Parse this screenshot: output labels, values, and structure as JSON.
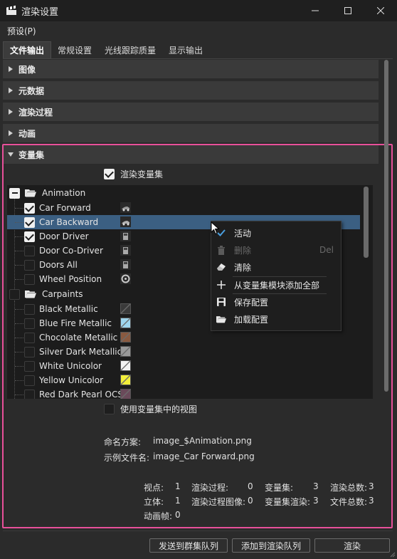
{
  "window": {
    "title": "渲染设置",
    "app_icon": "clapperboard-icon"
  },
  "menu": {
    "presets": "预设(P)"
  },
  "tabs": [
    {
      "label": "文件输出",
      "active": true
    },
    {
      "label": "常规设置",
      "active": false
    },
    {
      "label": "光线跟踪质量",
      "active": false
    },
    {
      "label": "显示输出",
      "active": false
    }
  ],
  "sections": [
    {
      "label": "图像",
      "expanded": false
    },
    {
      "label": "元数据",
      "expanded": false
    },
    {
      "label": "渲染过程",
      "expanded": false
    },
    {
      "label": "动画",
      "expanded": false
    },
    {
      "label": "变量集",
      "expanded": true
    }
  ],
  "variant_sets": {
    "render_variant_sets": {
      "label": "渲染变量集",
      "checked": true
    },
    "use_view": {
      "label": "使用变量集中的视图",
      "checked": false
    },
    "tree": {
      "groups": [
        {
          "label": "Animation",
          "state": "partial",
          "items": [
            {
              "label": "Car Forward",
              "checked": true,
              "selected": false
            },
            {
              "label": "Car Backward",
              "checked": true,
              "selected": true
            },
            {
              "label": "Door Driver",
              "checked": true,
              "selected": false
            },
            {
              "label": "Door Co-Driver",
              "checked": false,
              "selected": false
            },
            {
              "label": "Doors All",
              "checked": false,
              "selected": false
            },
            {
              "label": "Wheel Position",
              "checked": false,
              "selected": false
            }
          ]
        },
        {
          "label": "Carpaints",
          "state": "unchecked",
          "items": [
            {
              "label": "Black Metallic",
              "checked": false,
              "color": "#3a3a3a"
            },
            {
              "label": "Blue Fire Metallic",
              "checked": false,
              "color": "#9fd6ee"
            },
            {
              "label": "Chocolate Metallic",
              "checked": false,
              "color": "#8a5a40"
            },
            {
              "label": "Silver Dark Metallic",
              "checked": false,
              "color": "#9a9a9a"
            },
            {
              "label": "White Unicolor",
              "checked": false,
              "color": "#f2f2f2"
            },
            {
              "label": "Yellow Unicolor",
              "checked": false,
              "color": "#f3ef3a"
            },
            {
              "label": "Red Dark Pearl OCS",
              "checked": false,
              "color": "#6a4a5a"
            }
          ]
        }
      ]
    },
    "context_menu": {
      "items": [
        {
          "label": "活动",
          "icon": "checkmark-icon",
          "shortcut": "",
          "enabled": true
        },
        {
          "label": "删除",
          "icon": "trash-icon",
          "shortcut": "Del",
          "enabled": false
        },
        {
          "label": "清除",
          "icon": "eraser-icon",
          "shortcut": "",
          "enabled": true
        },
        {
          "label": "从变量集模块添加全部",
          "icon": "plus-icon",
          "shortcut": "",
          "enabled": true
        },
        {
          "label": "保存配置",
          "icon": "save-icon",
          "shortcut": "",
          "enabled": true
        },
        {
          "label": "加载配置",
          "icon": "folder-open-icon",
          "shortcut": "",
          "enabled": true
        }
      ]
    },
    "naming": {
      "scheme_label": "命名方案:",
      "scheme_value": "image_$Animation.png",
      "example_label": "示例文件名:",
      "example_value": "image_Car Forward.png"
    }
  },
  "stats": {
    "viewpoints_label": "视点:",
    "viewpoints_value": "1",
    "render_passes_label": "渲染过程:",
    "render_passes_value": "0",
    "variant_sets_label": "变量集:",
    "variant_sets_value": "3",
    "total_renders_label": "渲染总数:",
    "total_renders_value": "3",
    "stereo_label": "立体:",
    "stereo_value": "1",
    "pass_images_label": "渲染过程图像:",
    "pass_images_value": "0",
    "variant_renders_label": "变量集渲染:",
    "variant_renders_value": "3",
    "total_files_label": "文件总数:",
    "total_files_value": "3",
    "anim_frames_label": "动画帧:",
    "anim_frames_value": "0"
  },
  "buttons": {
    "send_cluster": "发送到群集队列",
    "add_queue": "添加到渲染队列",
    "render": "渲染"
  },
  "colors": {
    "highlight_border": "#e8509a",
    "selection": "#3b5f82"
  }
}
